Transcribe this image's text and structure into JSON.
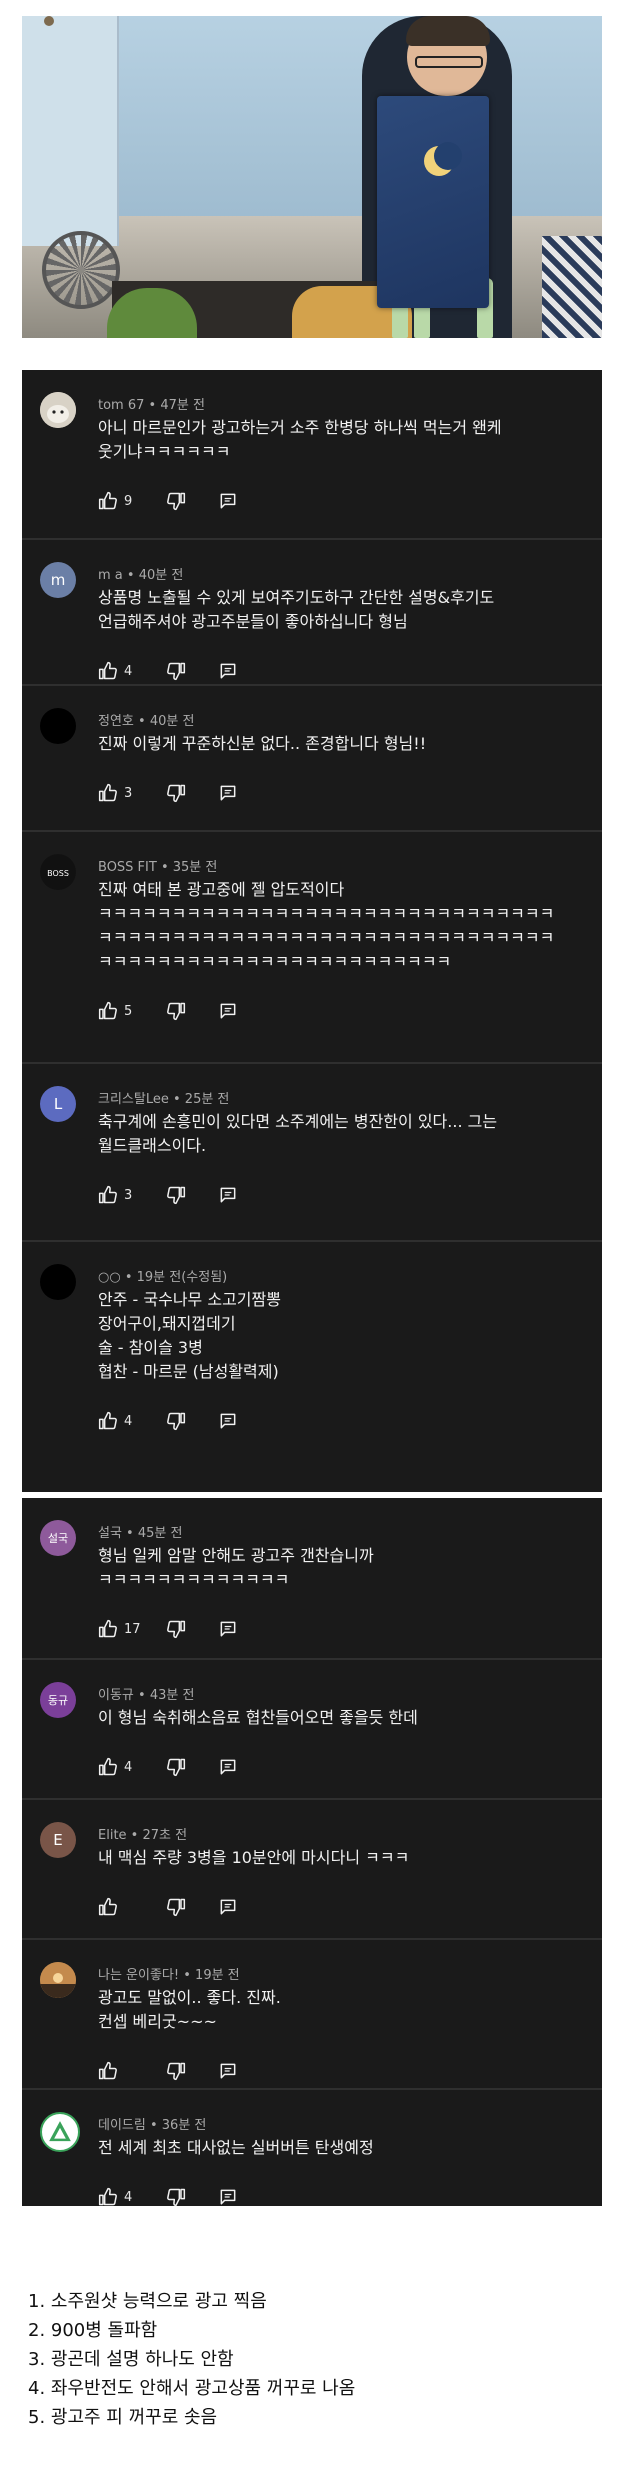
{
  "comments": [
    {
      "author": "tom 67",
      "time": "47분 전",
      "edited": "",
      "text": "아니 마르문인가 광고하는거 소주 한병당 하나씩 먹는거 왠케\n웃기냐ㅋㅋㅋㅋㅋㅋ",
      "likes": "9",
      "avatar_text": "",
      "avatar_color": "#c9c1b5"
    },
    {
      "author": "m a",
      "time": "40분 전",
      "edited": "",
      "text": "상품명 노출될 수 있게 보여주기도하구 간단한 설명&후기도\n언급해주셔야 광고주분들이 좋아하십니다 형님",
      "likes": "4",
      "avatar_text": "m",
      "avatar_color": "#6b7fa6"
    },
    {
      "author": "정연호",
      "time": "40분 전",
      "edited": "",
      "text": "진짜 이렇게 꾸준하신분 없다.. 존경합니다 형님!!",
      "likes": "3",
      "avatar_text": "",
      "avatar_color": "#000000"
    },
    {
      "author": "BOSS FIT",
      "time": "35분 전",
      "edited": "",
      "text": "진짜 여태 본 광고중에 젤 압도적이다\nㅋㅋㅋㅋㅋㅋㅋㅋㅋㅋㅋㅋㅋㅋㅋㅋㅋㅋㅋㅋㅋㅋㅋㅋㅋㅋㅋㅋㅋㅋㅋ\nㅋㅋㅋㅋㅋㅋㅋㅋㅋㅋㅋㅋㅋㅋㅋㅋㅋㅋㅋㅋㅋㅋㅋㅋㅋㅋㅋㅋㅋㅋㅋ\nㅋㅋㅋㅋㅋㅋㅋㅋㅋㅋㅋㅋㅋㅋㅋㅋㅋㅋㅋㅋㅋㅋㅋㅋ",
      "likes": "5",
      "avatar_text": "",
      "avatar_color": "#222222"
    },
    {
      "author": "크리스탈Lee",
      "time": "25분 전",
      "edited": "",
      "text": "축구계에 손흥민이 있다면 소주계에는 병잔한이 있다... 그는\n월드클래스이다.",
      "likes": "3",
      "avatar_text": "L",
      "avatar_color": "#5c6bc0"
    },
    {
      "author": "○○",
      "time": "19분 전",
      "edited": "(수정됨)",
      "text": "안주 - 국수나무 소고기짬뽕\n장어구이,돼지껍데기\n술 - 참이슬 3병\n협찬 - 마르문 (남성활력제)",
      "likes": "4",
      "avatar_text": "",
      "avatar_color": "#000000"
    },
    {
      "author": "설국",
      "time": "45분 전",
      "edited": "",
      "text": "형님 일케 암말 안해도 광고주 갠찬습니까\nㅋㅋㅋㅋㅋㅋㅋㅋㅋㅋㅋㅋㅋ",
      "likes": "17",
      "avatar_text": "설국",
      "avatar_color": "#8e5a9b"
    },
    {
      "author": "이동규",
      "time": "43분 전",
      "edited": "",
      "text": "이 형님 숙취해소음료 협찬들어오면 좋을듯 한데",
      "likes": "4",
      "avatar_text": "동규",
      "avatar_color": "#7b3f99"
    },
    {
      "author": "Elite",
      "time": "27초 전",
      "edited": "",
      "text": "내 맥심 주량 3병을 10분안에 마시다니 ㅋㅋㅋ",
      "likes": "",
      "avatar_text": "E",
      "avatar_color": "#795548"
    },
    {
      "author": "나는 운이좋다!",
      "time": "19분 전",
      "edited": "",
      "text": "광고도 말없이.. 좋다. 진짜.\n컨셉 베리굿~~~",
      "likes": "",
      "avatar_text": "",
      "avatar_color": "#8a6a46"
    },
    {
      "author": "데이드림",
      "time": "36분 전",
      "edited": "",
      "text": "전 세계 최초 대사없는 실버버튼 탄생예정",
      "likes": "4",
      "avatar_text": "",
      "avatar_color": "#ffffff"
    }
  ],
  "notes": [
    "1. 소주원샷 능력으로 광고 찍음",
    "2. 900병 돌파함",
    "3. 광곤데 설명 하나도 안함",
    "4. 좌우반전도 안해서 광고상품 꺼꾸로 나옴",
    "5. 광고주 피 꺼꾸로 솟음"
  ],
  "icons": {
    "like": "thumbs-up-icon",
    "dislike": "thumbs-down-icon",
    "reply": "reply-icon"
  }
}
